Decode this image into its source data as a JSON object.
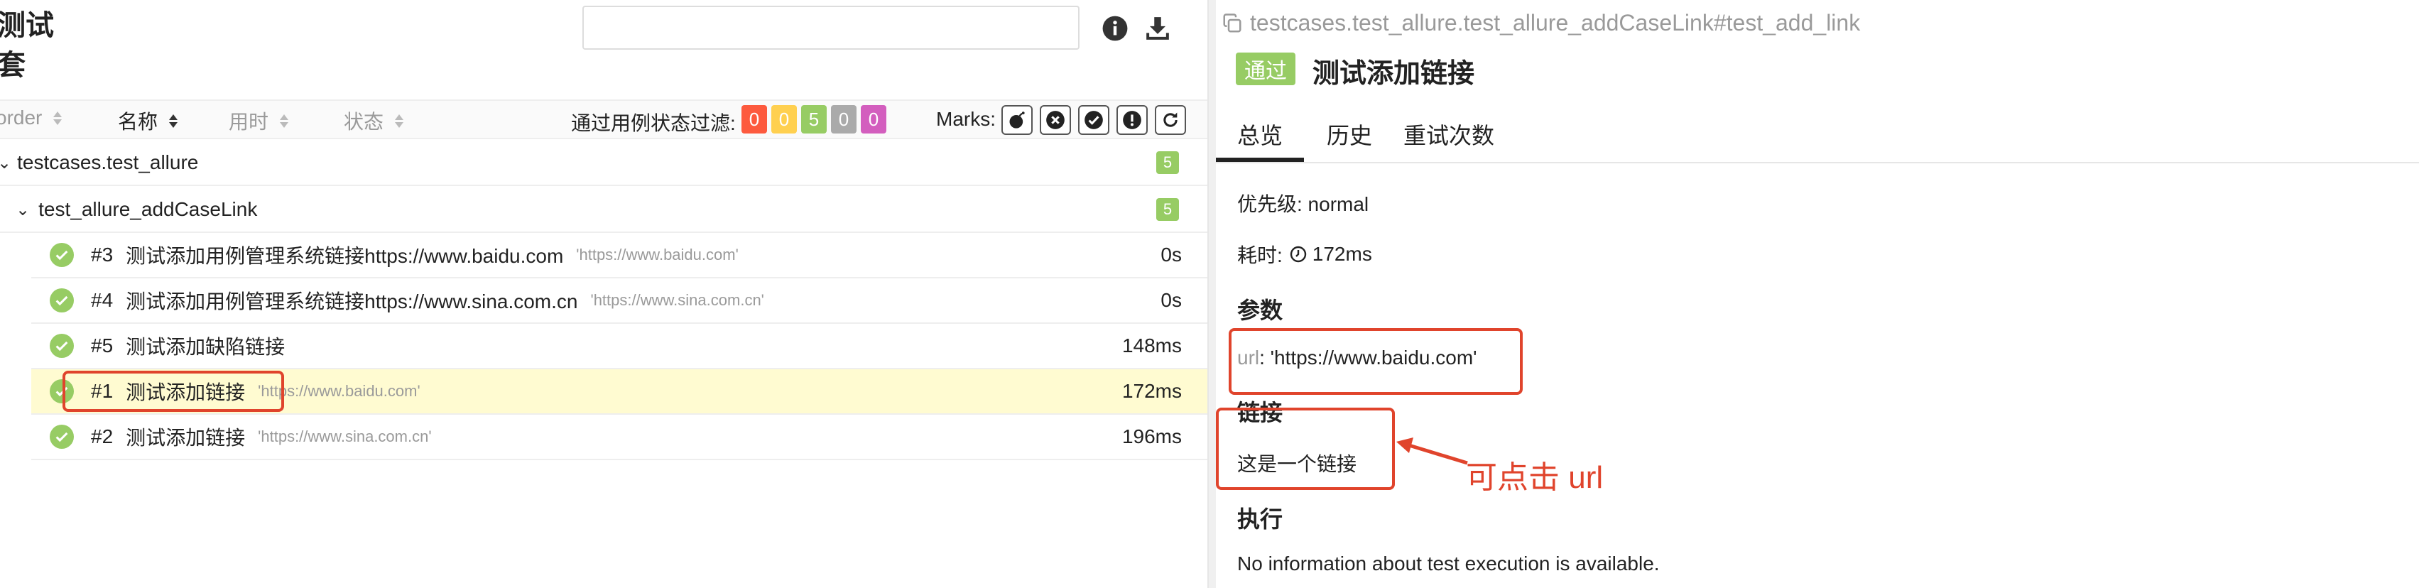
{
  "left": {
    "suite_title": "测试\n套",
    "search": {
      "placeholder": ""
    },
    "columns": {
      "order": "order",
      "name": "名称",
      "duration": "用时",
      "status": "状态"
    },
    "filter": {
      "label": "通过用例状态过滤:",
      "badges": [
        {
          "value": "0",
          "color": "#fd5a3e"
        },
        {
          "value": "0",
          "color": "#ffd050"
        },
        {
          "value": "5",
          "color": "#97cc64"
        },
        {
          "value": "0",
          "color": "#aaaaaa"
        },
        {
          "value": "0",
          "color": "#d35ebe"
        }
      ]
    },
    "marks": {
      "label": "Marks:"
    },
    "tree": {
      "suite": {
        "name": "testcases.test_allure",
        "count": "5"
      },
      "group": {
        "name": "test_allure_addCaseLink",
        "count": "5"
      },
      "cases": [
        {
          "num": "#3",
          "name": "测试添加用例管理系统链接https://www.baidu.com",
          "param": "'https://www.baidu.com'",
          "duration": "0s"
        },
        {
          "num": "#4",
          "name": "测试添加用例管理系统链接https://www.sina.com.cn",
          "param": "'https://www.sina.com.cn'",
          "duration": "0s"
        },
        {
          "num": "#5",
          "name": "测试添加缺陷链接",
          "param": "",
          "duration": "148ms"
        },
        {
          "num": "#1",
          "name": "测试添加链接",
          "param": "'https://www.baidu.com'",
          "duration": "172ms"
        },
        {
          "num": "#2",
          "name": "测试添加链接",
          "param": "'https://www.sina.com.cn'",
          "duration": "196ms"
        }
      ]
    }
  },
  "right": {
    "breadcrumb": "testcases.test_allure.test_allure_addCaseLink#test_add_link",
    "status": "通过",
    "title": "测试添加链接",
    "tabs": [
      "总览",
      "历史",
      "重试次数"
    ],
    "severity": "优先级: normal",
    "duration_label": "耗时:",
    "duration_value": "172ms",
    "params_title": "参数",
    "param_key": "url",
    "param_value": ": 'https://www.baidu.com'",
    "links_title": "链接",
    "link_text": "这是一个链接",
    "exec_title": "执行",
    "exec_text": "No information about test execution is available.",
    "annotation": "可点击 url"
  },
  "colors": {
    "passed": "#97cc64",
    "annotation": "#e0442c",
    "selected_row": "#fffbd1"
  }
}
